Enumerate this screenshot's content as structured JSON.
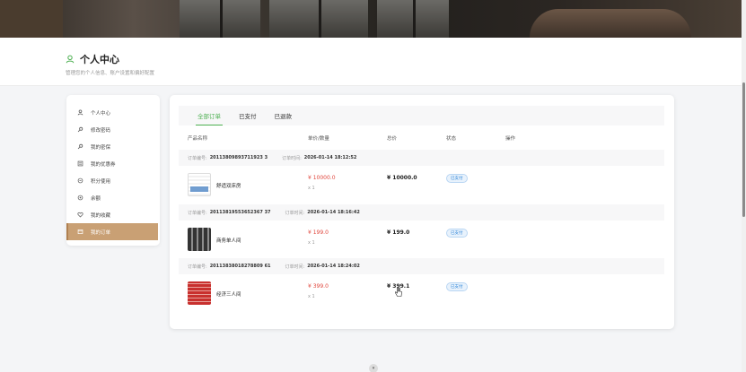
{
  "header": {
    "title": "个人中心",
    "subtitle": "管理您的个人信息、账户设置和偏好配置"
  },
  "sidebar": {
    "items": [
      {
        "label": "个人中心",
        "icon": "user-icon"
      },
      {
        "label": "修改密码",
        "icon": "key-icon"
      },
      {
        "label": "我的密保",
        "icon": "key-icon"
      },
      {
        "label": "我的优惠券",
        "icon": "coupon-icon"
      },
      {
        "label": "积分使用",
        "icon": "points-icon"
      },
      {
        "label": "余额",
        "icon": "balance-icon"
      },
      {
        "label": "我的收藏",
        "icon": "heart-icon"
      },
      {
        "label": "我的订单",
        "icon": "order-icon"
      }
    ],
    "active_index": 7,
    "accent": "#c9a074"
  },
  "tabs": [
    "全部订单",
    "已支付",
    "已退款"
  ],
  "table_headers": [
    "产品名称",
    "单价/数量",
    "总价",
    "状态",
    "操作"
  ],
  "order_labels": {
    "order_no": "订单编号:",
    "order_time": "订单时间:"
  },
  "orders": [
    {
      "order_no": "20113809893711923 3",
      "order_time": "2026-01-14 18:12:52",
      "product": "舒适双床房",
      "price": "¥ 10000.0",
      "qty": "x 1",
      "total": "¥ 10000.0",
      "status": "已支付"
    },
    {
      "order_no": "20113819553652367 37",
      "order_time": "2026-01-14 18:16:42",
      "product": "商务单人间",
      "price": "¥ 199.0",
      "qty": "x 1",
      "total": "¥ 199.0",
      "status": "已支付"
    },
    {
      "order_no": "20113838018278809 61",
      "order_time": "2026-01-14 18:24:02",
      "product": "经济三人间",
      "price": "¥ 399.0",
      "qty": "x 1",
      "total": "¥ 399.1",
      "status": "已支付"
    }
  ],
  "colors": {
    "tab_active": "#4caf50",
    "price": "#e0463c",
    "badge": "#2f86d8"
  }
}
